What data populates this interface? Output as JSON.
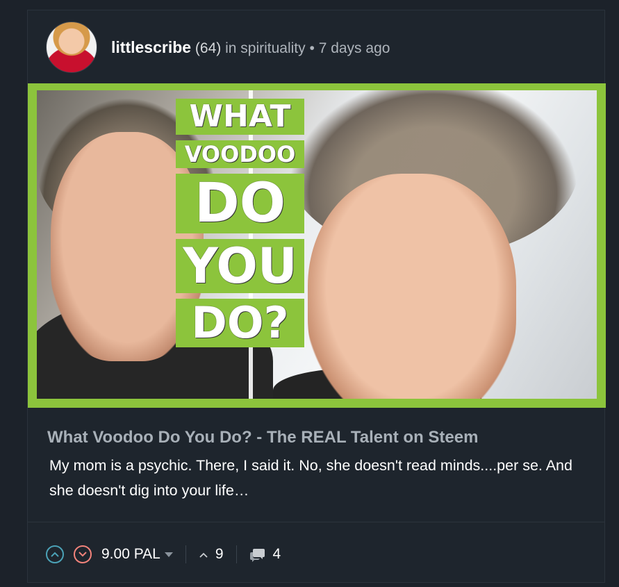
{
  "post": {
    "author": "littlescribe",
    "reputation": "(64)",
    "category_text": "in spirituality",
    "separator": "•",
    "time_ago": "7 days ago",
    "hero_image": {
      "title_lines": [
        "WHAT",
        "VOODOO",
        "DO",
        "YOU",
        "DO?"
      ],
      "border_color": "#8cc43c"
    },
    "title": "What Voodoo Do You Do? - The REAL Talent on Steem",
    "excerpt": "My mom is a psychic. There, I said it. No, she doesn't read minds....per se. And she doesn't dig into your life…"
  },
  "footer": {
    "payout": "9.00 PAL",
    "votes": "9",
    "comments": "4",
    "colors": {
      "upvote": "#4ba2b7",
      "downvote": "#f2837b"
    }
  }
}
